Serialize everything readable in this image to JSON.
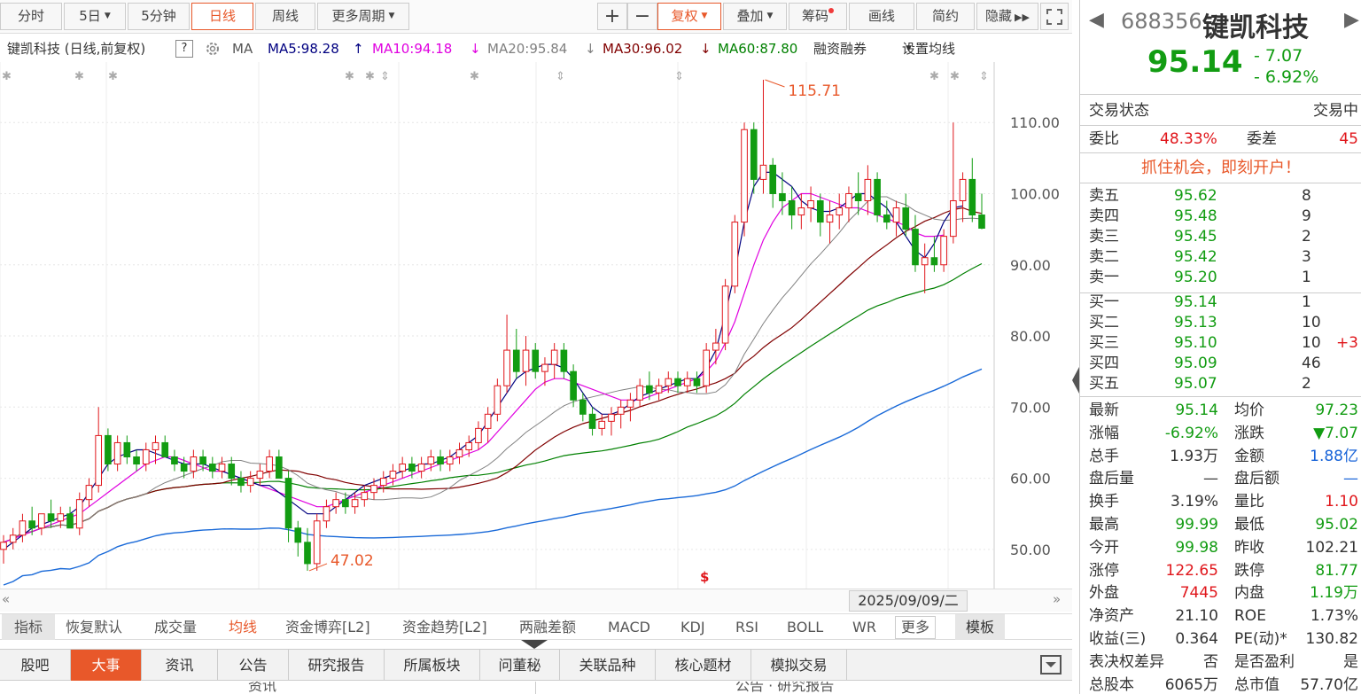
{
  "toolbar": {
    "items": [
      "分时",
      "5日",
      "5分钟",
      "日线",
      "周线",
      "更多周期"
    ],
    "zoom_in": "+",
    "zoom_out": "−",
    "fuquan": "复权",
    "overlay": "叠加",
    "chips": "筹码",
    "draw": "画线",
    "simple": "简约",
    "hide": "隐藏"
  },
  "ma_bar": {
    "title": "键凯科技 (日线,前复权)",
    "help": "?",
    "ma_label": "MA",
    "ma5": "MA5:98.28",
    "ma10": "MA10:94.18",
    "ma20": "MA20:95.84",
    "ma30": "MA30:96.02",
    "ma60": "MA60:87.80",
    "margin": "融资融券",
    "set_ma": "设置均线",
    "colors": {
      "ma5": "#000080",
      "ma10": "#e000e0",
      "ma20": "#808080",
      "ma30": "#800000",
      "ma60": "#008000",
      "ma120": "#1a6ad8"
    }
  },
  "chart_data": {
    "type": "candlestick",
    "ylim": [
      45,
      117
    ],
    "yticks": [
      "110.00",
      "100.00",
      "90.00",
      "80.00",
      "70.00",
      "60.00",
      "50.00"
    ],
    "ytick_values": [
      110,
      100,
      90,
      80,
      70,
      60,
      50
    ],
    "high_label": "115.71",
    "low_label": "47.02",
    "candles": [
      [
        50,
        52,
        48,
        51
      ],
      [
        51,
        53,
        50,
        52
      ],
      [
        52,
        55,
        51,
        54
      ],
      [
        54,
        56,
        52,
        53
      ],
      [
        53,
        55,
        52,
        55
      ],
      [
        55,
        57,
        53,
        54
      ],
      [
        54,
        56,
        53,
        55
      ],
      [
        55,
        56,
        53,
        53
      ],
      [
        53,
        58,
        52,
        57
      ],
      [
        57,
        60,
        56,
        59
      ],
      [
        59,
        70,
        58,
        66
      ],
      [
        66,
        67,
        61,
        62
      ],
      [
        62,
        66,
        61,
        65
      ],
      [
        65,
        66,
        62,
        63
      ],
      [
        63,
        64,
        61,
        62
      ],
      [
        62,
        65,
        61,
        64
      ],
      [
        64,
        66,
        62,
        65
      ],
      [
        65,
        66,
        63,
        63
      ],
      [
        63,
        64,
        61,
        62
      ],
      [
        62,
        63,
        60,
        61
      ],
      [
        61,
        64,
        60,
        63
      ],
      [
        63,
        64,
        61,
        62
      ],
      [
        62,
        63,
        60,
        61
      ],
      [
        61,
        63,
        60,
        62
      ],
      [
        62,
        63,
        59,
        60
      ],
      [
        60,
        61,
        58,
        59
      ],
      [
        59,
        61,
        58,
        60
      ],
      [
        60,
        62,
        59,
        61
      ],
      [
        61,
        64,
        60,
        63
      ],
      [
        63,
        64,
        60,
        60
      ],
      [
        60,
        61,
        51,
        53
      ],
      [
        53,
        54,
        49,
        51
      ],
      [
        51,
        53,
        47,
        48
      ],
      [
        48,
        55,
        47,
        54
      ],
      [
        54,
        57,
        53,
        56
      ],
      [
        56,
        58,
        55,
        57
      ],
      [
        57,
        58,
        55,
        56
      ],
      [
        56,
        58,
        55,
        57
      ],
      [
        57,
        59,
        56,
        58
      ],
      [
        58,
        60,
        57,
        59
      ],
      [
        59,
        61,
        58,
        60
      ],
      [
        60,
        62,
        59,
        61
      ],
      [
        61,
        63,
        60,
        62
      ],
      [
        62,
        63,
        60,
        61
      ],
      [
        61,
        63,
        60,
        62
      ],
      [
        62,
        64,
        61,
        63
      ],
      [
        63,
        64,
        61,
        62
      ],
      [
        62,
        64,
        61,
        63
      ],
      [
        63,
        65,
        62,
        64
      ],
      [
        64,
        66,
        63,
        65
      ],
      [
        65,
        68,
        64,
        67
      ],
      [
        67,
        70,
        65,
        69
      ],
      [
        69,
        74,
        68,
        73
      ],
      [
        73,
        83,
        72,
        78
      ],
      [
        78,
        81,
        74,
        75
      ],
      [
        75,
        80,
        73,
        78
      ],
      [
        78,
        79,
        74,
        75
      ],
      [
        75,
        77,
        73,
        76
      ],
      [
        76,
        79,
        74,
        78
      ],
      [
        78,
        79,
        74,
        75
      ],
      [
        75,
        76,
        70,
        71
      ],
      [
        71,
        72,
        68,
        69
      ],
      [
        69,
        70,
        66,
        67
      ],
      [
        67,
        69,
        66,
        68
      ],
      [
        68,
        70,
        66,
        69
      ],
      [
        69,
        71,
        67,
        70
      ],
      [
        70,
        72,
        68,
        71
      ],
      [
        71,
        74,
        70,
        73
      ],
      [
        73,
        75,
        71,
        72
      ],
      [
        72,
        74,
        71,
        73
      ],
      [
        73,
        75,
        72,
        74
      ],
      [
        74,
        75,
        72,
        73
      ],
      [
        73,
        75,
        72,
        74
      ],
      [
        74,
        75,
        72,
        73
      ],
      [
        73,
        79,
        72,
        78
      ],
      [
        78,
        81,
        76,
        79
      ],
      [
        79,
        88,
        78,
        87
      ],
      [
        87,
        97,
        86,
        96
      ],
      [
        96,
        110,
        94,
        109
      ],
      [
        109,
        110,
        100,
        102
      ],
      [
        102,
        116,
        100,
        104
      ],
      [
        104,
        105,
        98,
        100
      ],
      [
        100,
        103,
        97,
        99
      ],
      [
        99,
        101,
        95,
        97
      ],
      [
        97,
        100,
        95,
        98
      ],
      [
        98,
        101,
        96,
        99
      ],
      [
        99,
        100,
        94,
        96
      ],
      [
        96,
        99,
        93,
        97
      ],
      [
        97,
        100,
        95,
        98
      ],
      [
        98,
        101,
        96,
        100
      ],
      [
        100,
        103,
        97,
        99
      ],
      [
        99,
        104,
        97,
        102
      ],
      [
        102,
        103,
        96,
        97
      ],
      [
        97,
        99,
        95,
        96
      ],
      [
        96,
        99,
        94,
        98
      ],
      [
        98,
        100,
        94,
        95
      ],
      [
        95,
        97,
        89,
        90
      ],
      [
        90,
        93,
        86,
        91
      ],
      [
        91,
        94,
        89,
        90
      ],
      [
        90,
        95,
        89,
        94
      ],
      [
        94,
        110,
        93,
        99
      ],
      [
        99,
        103,
        96,
        102
      ],
      [
        102,
        105,
        96,
        97
      ],
      [
        97,
        100,
        95,
        95.14
      ]
    ],
    "ma5": [
      50,
      51,
      52,
      53,
      53.5,
      54,
      54.5,
      55,
      56,
      58,
      60,
      62,
      63,
      63.5,
      64,
      64,
      63.5,
      63,
      62.5,
      62,
      62,
      62,
      61.5,
      61,
      60.5,
      60,
      59.5,
      59,
      59,
      58,
      57,
      56,
      55,
      55,
      55,
      56,
      57,
      58,
      59,
      59.5,
      60,
      60.5,
      61,
      61.5,
      62,
      62,
      62.5,
      63,
      64,
      65,
      66,
      68,
      70,
      72,
      74,
      75,
      75.5,
      76,
      76,
      75.5,
      74,
      72,
      70,
      69,
      69,
      69.5,
      70.5,
      71.5,
      72,
      72.5,
      73,
      73.5,
      74,
      74,
      75.5,
      78,
      83,
      89,
      96,
      101,
      103,
      103,
      102,
      101,
      99,
      98,
      97.5,
      97.5,
      98,
      99,
      100,
      100,
      99,
      98,
      96,
      94,
      92,
      91,
      93,
      96,
      98,
      98.28
    ],
    "ma10": [
      51,
      51.5,
      52,
      52.5,
      53,
      53.5,
      54,
      54.5,
      55,
      56,
      57,
      58,
      59,
      60,
      61,
      62,
      62.5,
      63,
      63,
      62.5,
      62,
      61.5,
      61,
      61,
      60.5,
      60,
      59.5,
      59,
      58.5,
      58,
      57.5,
      57,
      56.5,
      56,
      56,
      56.5,
      57,
      57.5,
      58,
      58.5,
      59,
      59.5,
      60,
      60.5,
      61,
      61.5,
      62,
      62.5,
      63,
      63.5,
      64,
      65,
      66.5,
      68,
      69.5,
      71,
      72.5,
      73.5,
      74,
      74,
      73.5,
      73,
      72.5,
      72,
      71.5,
      71,
      71,
      71,
      71.5,
      72,
      72.5,
      73,
      73.5,
      74,
      75,
      76.5,
      79,
      82,
      86,
      90,
      93.5,
      96,
      98,
      99,
      100,
      100,
      99.5,
      99,
      98.5,
      98,
      98,
      97.5,
      97,
      96.5,
      96,
      95.5,
      94.5,
      94,
      94,
      94.18
    ]
  },
  "date_label": "2025/09/09/二",
  "indicators": [
    "指标",
    "恢复默认",
    "成交量",
    "均线",
    "资金博弈[L2]",
    "资金趋势[L2]",
    "两融差额",
    "MACD",
    "KDJ",
    "RSI",
    "BOLL",
    "WR",
    "更多",
    "模板"
  ],
  "tabs": [
    "股吧",
    "大事",
    "资讯",
    "公告",
    "研究报告",
    "所属板块",
    "问董秘",
    "关联品种",
    "核心题材",
    "模拟交易"
  ],
  "footer_partial": [
    "资讯",
    "公告 · 研究报告"
  ],
  "quote": {
    "code": "688356",
    "name": "键凯科技",
    "price": "95.14",
    "change": "- 7.07",
    "pct": "- 6.92%",
    "status_label": "交易状态",
    "status_value": "交易中",
    "weibi_label": "委比",
    "weibi_value": "48.33%",
    "weicha_label": "委差",
    "weicha_value": "45",
    "promo": "抓住机会，即刻开户！",
    "asks": [
      {
        "label": "卖五",
        "price": "95.62",
        "vol": "8"
      },
      {
        "label": "卖四",
        "price": "95.48",
        "vol": "9"
      },
      {
        "label": "卖三",
        "price": "95.45",
        "vol": "2"
      },
      {
        "label": "卖二",
        "price": "95.42",
        "vol": "3"
      },
      {
        "label": "卖一",
        "price": "95.20",
        "vol": "1"
      }
    ],
    "bids": [
      {
        "label": "买一",
        "price": "95.14",
        "vol": "1",
        "delta": ""
      },
      {
        "label": "买二",
        "price": "95.13",
        "vol": "10",
        "delta": ""
      },
      {
        "label": "买三",
        "price": "95.10",
        "vol": "10",
        "delta": "+3"
      },
      {
        "label": "买四",
        "price": "95.09",
        "vol": "46",
        "delta": ""
      },
      {
        "label": "买五",
        "price": "95.07",
        "vol": "2",
        "delta": ""
      }
    ],
    "stats": [
      [
        "最新",
        "95.14",
        "green",
        "均价",
        "97.23",
        "green"
      ],
      [
        "涨幅",
        "-6.92%",
        "green",
        "涨跌",
        "▼7.07",
        "green"
      ],
      [
        "总手",
        "1.93万",
        "dark",
        "金额",
        "1.88亿",
        "blue"
      ],
      [
        "盘后量",
        "—",
        "dark",
        "盘后额",
        "—",
        "blue"
      ],
      [
        "换手",
        "3.19%",
        "dark",
        "量比",
        "1.10",
        "red"
      ],
      [
        "最高",
        "99.99",
        "green",
        "最低",
        "95.02",
        "green"
      ],
      [
        "今开",
        "99.98",
        "green",
        "昨收",
        "102.21",
        "dark"
      ],
      [
        "涨停",
        "122.65",
        "red",
        "跌停",
        "81.77",
        "green"
      ],
      [
        "外盘",
        "7445",
        "red",
        "内盘",
        "1.19万",
        "green"
      ],
      [
        "净资产",
        "21.10",
        "dark",
        "ROE",
        "1.73%",
        "dark"
      ],
      [
        "收益(三)",
        "0.364",
        "dark",
        "PE(动)*",
        "130.82",
        "dark"
      ],
      [
        "表决权差异",
        "否",
        "dark",
        "是否盈利",
        "是",
        "dark"
      ],
      [
        "总股本",
        "6065万",
        "dark",
        "总市值",
        "57.70亿",
        "dark"
      ]
    ]
  }
}
